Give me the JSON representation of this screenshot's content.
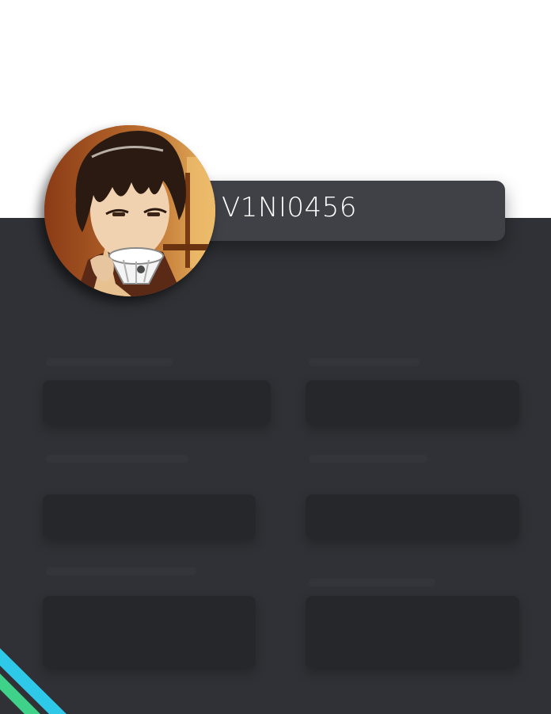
{
  "profile": {
    "username": "V1NI0456",
    "avatar_icon": "anime-character-avatar"
  },
  "theme": {
    "background_top": "#ffffff",
    "panel": "#303136",
    "name_bar": "#3f4147",
    "card": "#26272b",
    "accent_cyan": "#2ec8e8",
    "accent_green": "#3fd38a"
  }
}
